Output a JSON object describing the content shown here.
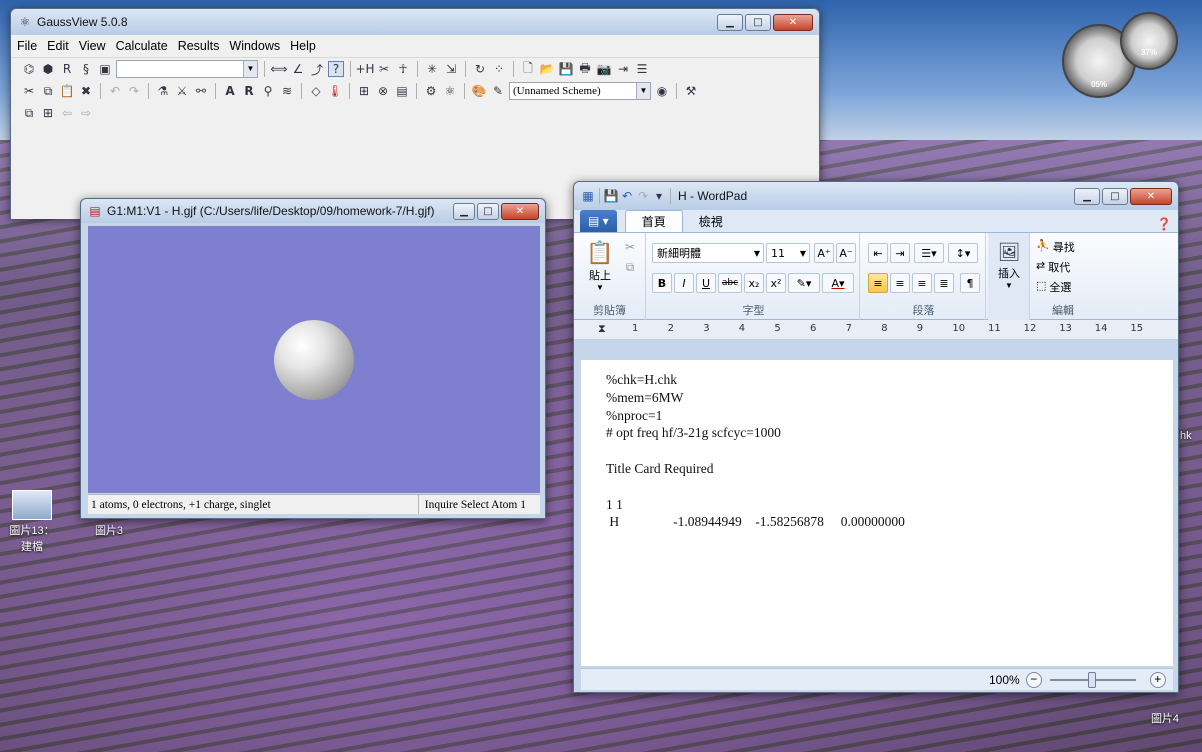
{
  "desktop": {
    "icons": [
      {
        "label": "圖片13：建檔"
      },
      {
        "label": "圖片3"
      },
      {
        "label": "圖片4"
      }
    ],
    "side_label": "hk",
    "gadget": {
      "cpu": "05%",
      "memory": "37%"
    }
  },
  "gaussview": {
    "title": "GaussView 5.0.8",
    "menu": [
      "File",
      "Edit",
      "View",
      "Calculate",
      "Results",
      "Windows",
      "Help"
    ],
    "scheme": "(Unnamed Scheme)"
  },
  "molecule_window": {
    "title": "G1:M1:V1 - H.gjf (C:/Users/life/Desktop/09/homework-7/H.gjf)",
    "status_left": "1 atoms, 0 electrons, +1 charge, singlet",
    "status_right": "Inquire  Select Atom 1"
  },
  "wordpad": {
    "title": "H - WordPad",
    "tabs": [
      "首頁",
      "檢視"
    ],
    "groups": {
      "clipboard": "剪貼簿",
      "font": "字型",
      "paragraph": "段落",
      "insert": "插入",
      "edit": "編輯"
    },
    "paste_label": "貼上",
    "font_name": "新細明體",
    "font_size": "11",
    "edit_actions": [
      "尋找",
      "取代",
      "全選"
    ],
    "ruler_numbers": [
      "1",
      "2",
      "3",
      "4",
      "5",
      "6",
      "7",
      "8",
      "9",
      "10",
      "11",
      "12",
      "13",
      "14",
      "15"
    ],
    "document_lines": [
      "%chk=H.chk",
      "%mem=6MW",
      "%nproc=1",
      "# opt freq hf/3-21g scfcyc=1000",
      "",
      "Title Card Required",
      "",
      "1 1",
      " H                -1.08944949    -1.58256878     0.00000000"
    ],
    "zoom": "100%"
  }
}
